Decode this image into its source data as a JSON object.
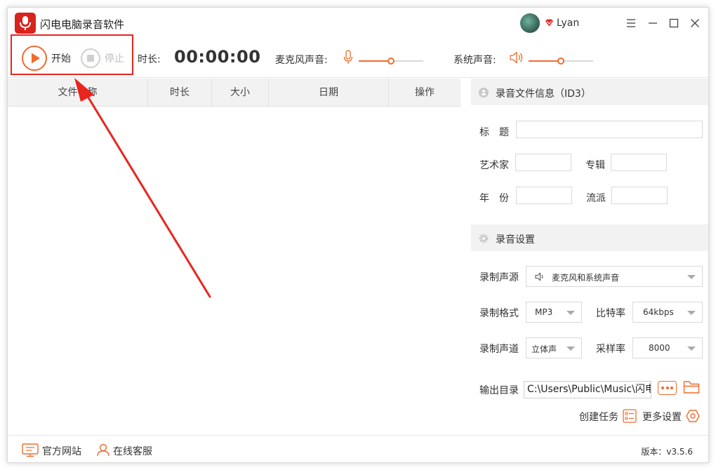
{
  "app": {
    "title": "闪电电脑录音软件",
    "user_name": "Lyan"
  },
  "toolbar": {
    "start_label": "开始",
    "stop_label": "停止",
    "duration_label": "时长:",
    "duration_value": "00:00:00",
    "mic_label": "麦克风声音:",
    "mic_level": 0.5,
    "system_label": "系统声音:",
    "system_level": 0.5
  },
  "table": {
    "columns": [
      "文件名称",
      "时长",
      "大小",
      "日期",
      "操作"
    ],
    "rows": []
  },
  "id3": {
    "header": "录音文件信息（ID3）",
    "title_label": "标　题",
    "title_value": "",
    "artist_label": "艺术家",
    "artist_value": "",
    "album_label": "专辑",
    "album_value": "",
    "year_label": "年　份",
    "year_value": "",
    "genre_label": "流派",
    "genre_value": ""
  },
  "settings": {
    "header": "录音设置",
    "source_label": "录制声源",
    "source_value": "麦克风和系统声音",
    "format_label": "录制格式",
    "format_value": "MP3",
    "bitrate_label": "比特率",
    "bitrate_value": "64kbps",
    "channel_label": "录制声道",
    "channel_value": "立体声",
    "samplerate_label": "采样率",
    "samplerate_value": "8000",
    "output_label": "输出目录",
    "output_value": "C:\\Users\\Public\\Music\\闪电",
    "create_task_label": "创建任务",
    "more_settings_label": "更多设置"
  },
  "footer": {
    "website_label": "官方网站",
    "support_label": "在线客服",
    "version": "版本：v3.5.6"
  },
  "colors": {
    "accent": "#ef6b2d",
    "brand": "#d9231d",
    "annotation": "#e8251f"
  }
}
